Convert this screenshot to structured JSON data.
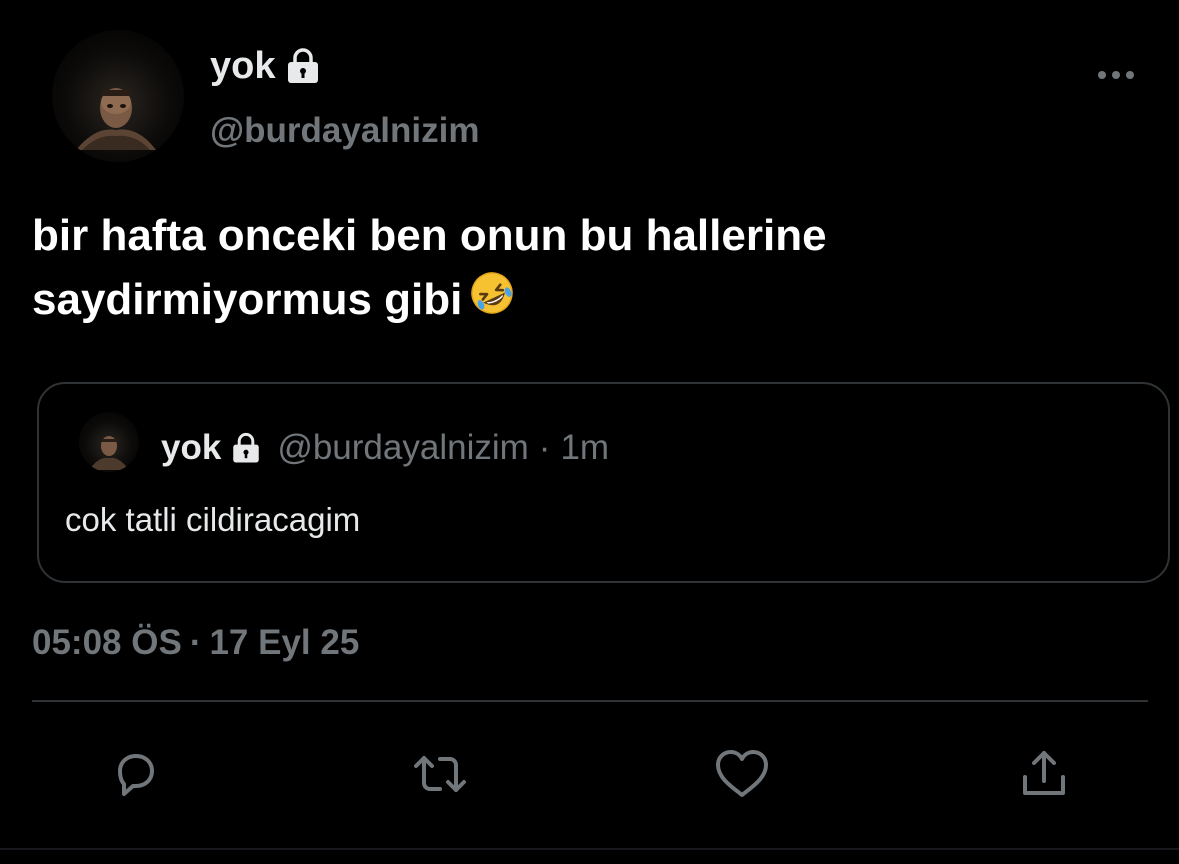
{
  "author": {
    "display_name": "yok",
    "handle": "@burdayalnizim",
    "protected": true
  },
  "tweet": {
    "lines": [
      "bir hafta onceki ben onun bu hallerine",
      "saydirmiyormus gibi"
    ],
    "emoji": "rolling-on-the-floor-laughing"
  },
  "quoted_tweet": {
    "display_name": "yok",
    "handle": "@burdayalnizim",
    "separator": "·",
    "time_ago": "1m",
    "text": "cok tatli cildiracagim"
  },
  "meta": {
    "time": "05:08 ÖS",
    "separator": "·",
    "date": "17 Eyl 25"
  },
  "actions": [
    {
      "name": "reply",
      "icon": "reply-icon"
    },
    {
      "name": "retweet",
      "icon": "retweet-icon"
    },
    {
      "name": "like",
      "icon": "heart-icon"
    },
    {
      "name": "share",
      "icon": "share-icon"
    }
  ],
  "colors": {
    "background": "#000000",
    "text_primary": "#e7e9ea",
    "text_secondary": "#71767b",
    "border": "#2f3336",
    "icon": "#71767b"
  }
}
